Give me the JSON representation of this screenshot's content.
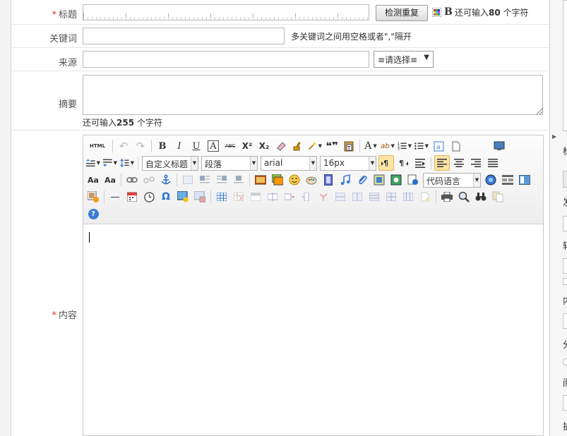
{
  "form": {
    "title": {
      "label": "标题",
      "required_mark": "*",
      "value": "",
      "check_button": "检测重复",
      "bold_icon_text": "B",
      "remain_prefix": "还可输入",
      "remain_count": "80",
      "remain_suffix": "个字符"
    },
    "keywords": {
      "label": "关键词",
      "value": "",
      "hint": "多关键词之间用空格或者\",\"隔开"
    },
    "source": {
      "label": "来源",
      "value": "",
      "select_value": "≡请选择≡",
      "select_arrow": "▼"
    },
    "summary": {
      "label": "摘要",
      "value": "",
      "remain_prefix": "还可输入",
      "remain_count": "255",
      "remain_suffix": "个字符"
    },
    "content": {
      "label": "内容",
      "required_mark": "*"
    }
  },
  "editor": {
    "row1": {
      "html": "HTML",
      "undo": "↶",
      "redo": "↷",
      "bold": "B",
      "italic": "I",
      "underline": "U",
      "fontborder": "A",
      "strikethrough": "ABC",
      "superscript": "X²",
      "subscript": "X₂",
      "blockquote": "❝❞",
      "forecolor": "A",
      "backcolor": "ab"
    },
    "row2": {
      "custom_title": "自定义标题",
      "paragraph": "段落",
      "font_family": "arial",
      "font_size": "16px"
    },
    "row3": {
      "code_language": "代码语言"
    },
    "row4": {
      "horizontal": "—",
      "special_char": "Ω",
      "help": "?"
    }
  },
  "right_panel": {
    "glyphs": [
      "标",
      "发",
      "转",
      "内",
      "分",
      "阅",
      "扩"
    ]
  },
  "colors": {
    "required": "#e03030",
    "active_button": "#fbe4a6",
    "help_icon": "#3a7bd5"
  }
}
